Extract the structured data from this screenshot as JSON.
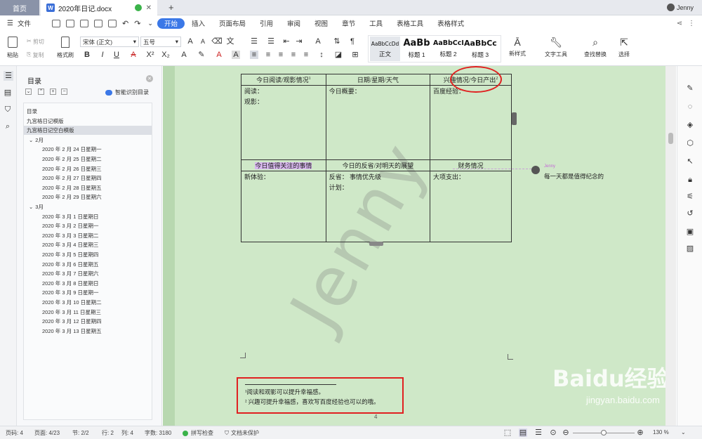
{
  "tabs": {
    "home": "首页",
    "doc": "2020年日记.docx",
    "new": "+"
  },
  "user": {
    "name": "Jenny"
  },
  "menu": {
    "file": "文件",
    "items": [
      "开始",
      "插入",
      "页面布局",
      "引用",
      "审阅",
      "视图",
      "章节",
      "工具",
      "表格工具",
      "表格样式"
    ]
  },
  "ribbon": {
    "paste": "粘贴",
    "cut": "剪切",
    "copy": "复制",
    "format_painter": "格式刷",
    "font": "宋体 (正文)",
    "size": "五号",
    "styles": [
      {
        "sample": "AaBbCcDd",
        "label": "正文"
      },
      {
        "sample": "AaBb",
        "label": "标题 1"
      },
      {
        "sample": "AaBbCcI",
        "label": "标题 2"
      },
      {
        "sample": "AaBbCc",
        "label": "标题 3"
      }
    ],
    "new_style": "新样式",
    "text_tools": "文字工具",
    "find_replace": "查找替换",
    "select": "选择"
  },
  "nav": {
    "title": "目录",
    "smart": "智能识别目录",
    "items": [
      "目录",
      "九宫格日记模版",
      "九宫格日记空白模版",
      "2月",
      "2020 年 2 月 24 日星期一",
      "2020 年 2 月 25 日星期二",
      "2020 年 2 月 26 日星期三",
      "2020 年 2 月 27 日星期四",
      "2020 年 2 月 28 日星期五",
      "2020 年 2 月 29 日星期六",
      "3月",
      "2020 年 3 月 1 日星期日",
      "2020 年 3 月 2 日星期一",
      "2020 年 3 月 3 日星期二",
      "2020 年 3 月 4 日星期三",
      "2020 年 3 月 5 日星期四",
      "2020 年 3 月 6 日星期五",
      "2020 年 3 月 7 日星期六",
      "2020 年 3 月 8 日星期日",
      "2020 年 3 月 9 日星期一",
      "2020 年 3 月 10 日星期二",
      "2020 年 3 月 11 日星期三",
      "2020 年 3 月 12 日星期四",
      "2020 年 3 月 13 日星期五"
    ]
  },
  "table": {
    "h1": [
      "今日阅读/观影情况",
      "日期/星期/天气",
      "兴趣情况/今日产出"
    ],
    "h1_sup": [
      "1",
      "",
      "2"
    ],
    "c1": [
      "阅读：",
      "观影：",
      "今日概要：",
      "百度经验："
    ],
    "h2": [
      "今日值得关注的事情",
      "今日的反省/对明天的展望",
      "财务情况"
    ],
    "c2": [
      "新体验：",
      "反省：  事情优先级",
      "计划：",
      "大项支出："
    ]
  },
  "watermark": "Jenny",
  "comment": {
    "author": "Jenny",
    "text": "每一天都是值得纪念的"
  },
  "footnotes": [
    "¹阅读和观影可以提升幸福感。",
    "²  兴趣可提升幸福感，喜欢写百度经验也可以的哦。"
  ],
  "page_number": "4",
  "baidu": {
    "logo": "Baidu经验",
    "url": "jingyan.baidu.com"
  },
  "status": {
    "page_count": "页码: 4",
    "pages": "页面: 4/23",
    "section": "节: 2/2",
    "row": "行: 2",
    "col": "列: 4",
    "chars": "字数: 3180",
    "spell": "拼写检查",
    "protect": "文档未保护",
    "zoom": "130 %"
  },
  "colors": {
    "accent": "#3b78e7",
    "doc_bg": "#cfe8c8",
    "annotation": "#e02020"
  }
}
